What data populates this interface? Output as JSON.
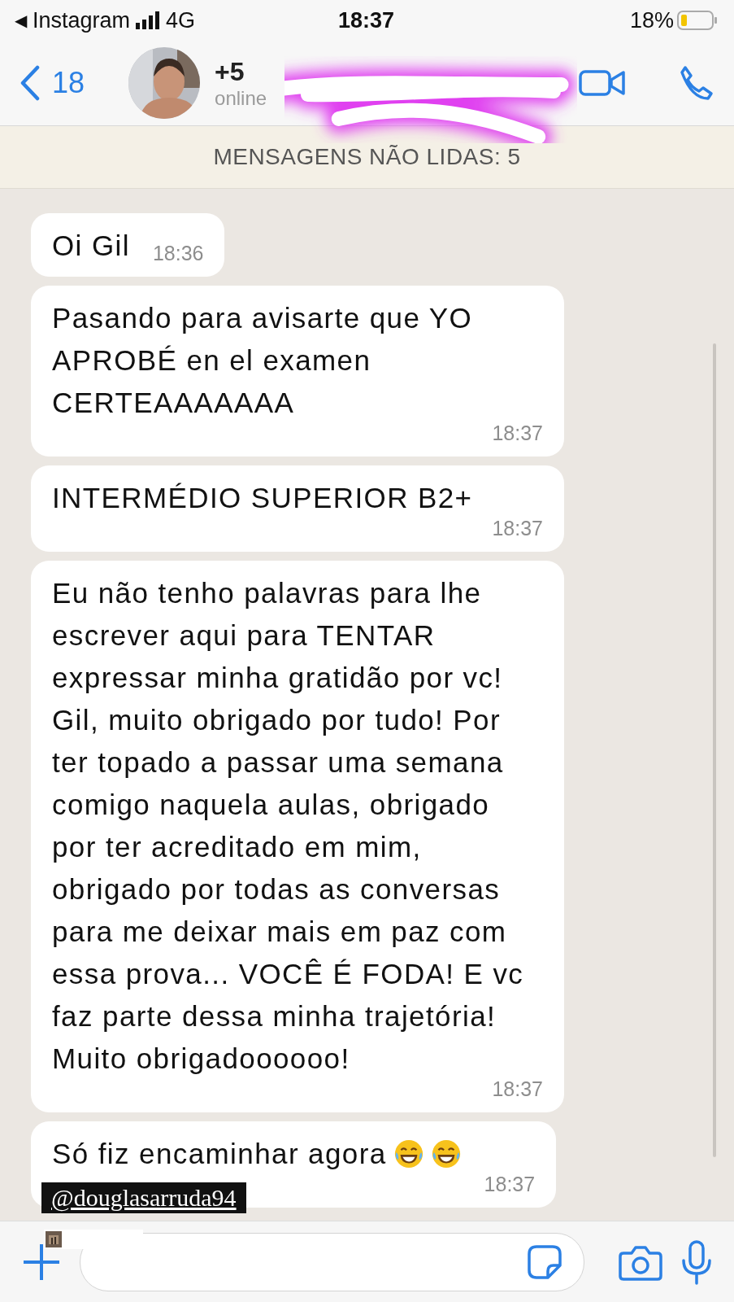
{
  "status_bar": {
    "back_glyph": "◀",
    "back_app": "Instagram",
    "network": "4G",
    "time": "18:37",
    "battery": "18%"
  },
  "header": {
    "back_count": "18",
    "contact_name": "+5",
    "presence": "online"
  },
  "unread_banner": "MENSAGENS NÃO LIDAS: 5",
  "messages": [
    {
      "kind": "text",
      "text": "Oi Gil",
      "time": "18:36"
    },
    {
      "kind": "text",
      "text": "Pasando para avisarte que YO APROBÉ en el examen CERTEAAAAAAA",
      "time": "18:37"
    },
    {
      "kind": "text",
      "text": "INTERMÉDIO SUPERIOR B2+",
      "time": "18:37"
    },
    {
      "kind": "text",
      "text": "Eu não tenho palavras para lhe escrever aqui para TENTAR expressar minha gratidão por vc! Gil, muito obrigado por tudo! Por ter topado a passar uma semana comigo naquela aulas, obrigado por ter acreditado em mim, obrigado por todas as conversas para me deixar mais em paz com essa prova... VOCÊ É FODA! E vc faz parte dessa minha trajetória! Muito obrigadoooooo!",
      "time": "18:37"
    },
    {
      "kind": "text-emoji",
      "text": "Só fiz encaminhar agora",
      "time": "18:37"
    }
  ],
  "mention_sticker": "@douglasarruda94"
}
